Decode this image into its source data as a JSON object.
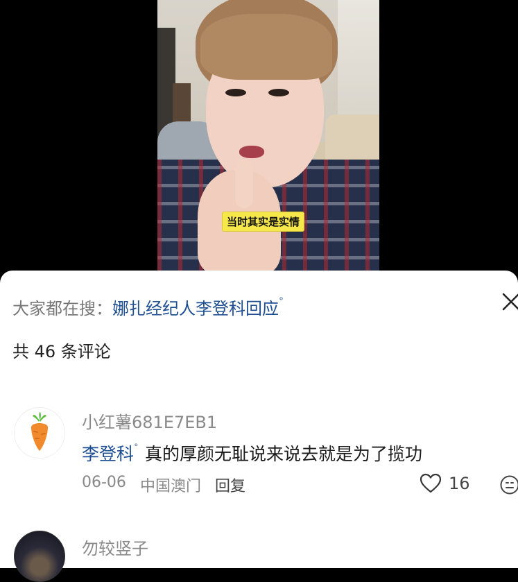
{
  "video": {
    "subtitle": "当时其实是实情"
  },
  "sheet": {
    "search_prefix": "大家都在搜：",
    "search_term": "娜扎经纪人李登科回应",
    "search_icon_glyph": "ᵒ",
    "comment_count": "共 46 条评论",
    "close_icon": "close-icon"
  },
  "comments": [
    {
      "username": "小红薯681E7EB1",
      "mention": "李登科",
      "mention_icon_glyph": "ᵒ",
      "text": "真的厚颜无耻说来说去就是为了揽功",
      "date": "06-06",
      "location": "中国澳门",
      "reply_label": "回复",
      "likes": "16",
      "avatar_icon": "carrot-icon"
    },
    {
      "username": "勿较竖子",
      "avatar_icon": "photo-avatar"
    }
  ],
  "colors": {
    "link_blue": "#1f4f93",
    "subtitle_bg": "#f6e84b",
    "carrot_orange": "#f08a2c",
    "carrot_leaf": "#5cbf3b"
  }
}
